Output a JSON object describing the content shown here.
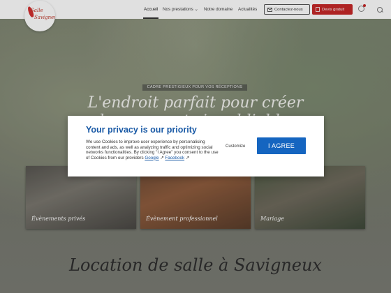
{
  "header": {
    "logo_line1": "Salle",
    "logo_line2": "Savigneux",
    "nav": [
      {
        "label": "Accueil"
      },
      {
        "label": "Nos prestations",
        "chevron": "⌄"
      },
      {
        "label": "Notre domaine"
      },
      {
        "label": "Actualités"
      }
    ],
    "contact_label": "Contactez-nous",
    "devis_label": "Devis gratuit"
  },
  "hero": {
    "tag": "CADRE PRESTIGIEUX POUR VOS RÉCEPTIONS",
    "headline_line1": "L'endroit parfait pour créer",
    "headline_line2": "des moments inoubliables"
  },
  "cards": [
    {
      "label": "Évènements privés"
    },
    {
      "label": "Évènement professionnel"
    },
    {
      "label": "Mariage"
    }
  ],
  "section_title": "Location de salle à Savigneux",
  "modal": {
    "title": "Your privacy is our priority",
    "text": "We use Cookies to improve user experience by personalising content and ads, as well as analyzing traffic and optimizing social networks functionalities. By clicking \"I Agree\" you consent to the use of Cookies from our providers",
    "link_google": "Google",
    "link_facebook": "Facebook",
    "customize_label": "Customize",
    "agree_label": "I AGREE"
  },
  "colors": {
    "accent_red": "#c62828",
    "modal_blue": "#1565c0"
  }
}
